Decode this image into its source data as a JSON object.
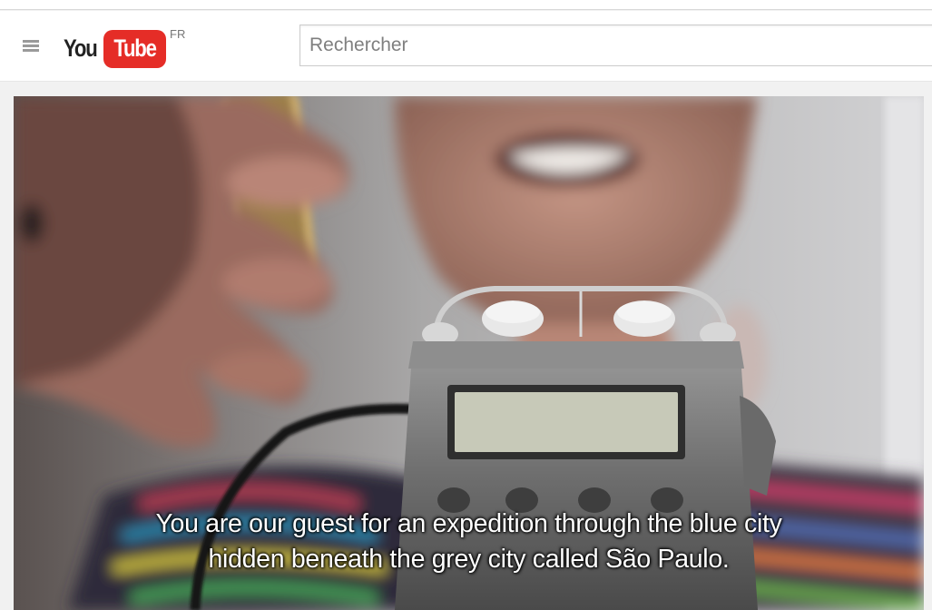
{
  "header": {
    "logo": {
      "you": "You",
      "tube": "Tube",
      "country_code": "FR"
    },
    "search": {
      "placeholder": "Rechercher",
      "value": ""
    }
  },
  "player": {
    "captions": [
      "You are our guest for an expedition through the blue city",
      "hidden beneath the grey city called São Paulo."
    ]
  },
  "colors": {
    "brand_red": "#e52d27",
    "masthead_bg": "#ffffff",
    "page_bg": "#f1f1f1"
  },
  "icons": {
    "menu": "menu-icon"
  }
}
